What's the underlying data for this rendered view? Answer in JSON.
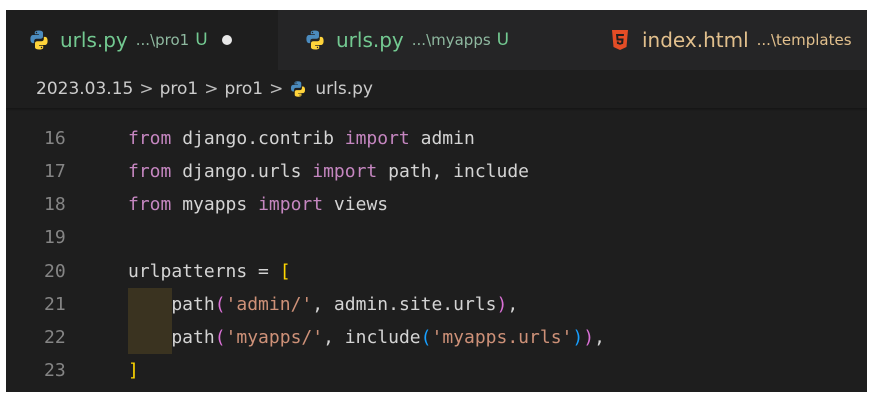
{
  "tabs": [
    {
      "name": "urls.py",
      "path": "...\\pro1",
      "flag": "U",
      "dirty": true,
      "icon": "python-icon",
      "active": true
    },
    {
      "name": "urls.py",
      "path": "...\\myapps",
      "flag": "U",
      "dirty": false,
      "icon": "python-icon",
      "active": false
    },
    {
      "name": "index.html",
      "path": "...\\templates",
      "flag": "",
      "dirty": false,
      "icon": "html5-icon",
      "active": false
    }
  ],
  "breadcrumb": {
    "items": [
      "2023.03.15",
      "pro1",
      "pro1",
      "urls.py"
    ],
    "separator": ">"
  },
  "editor": {
    "line_numbers": [
      "16",
      "17",
      "18",
      "19",
      "20",
      "21",
      "22",
      "23"
    ],
    "lines": [
      [
        "from",
        " django.contrib ",
        "import",
        " admin"
      ],
      [
        "from",
        " django.urls ",
        "import",
        " path, include"
      ],
      [
        "from",
        " myapps ",
        "import",
        " views"
      ],
      [],
      [
        "urlpatterns = ",
        "["
      ],
      [
        "    path",
        "(",
        "'admin/'",
        ", admin.site.urls",
        ")",
        ","
      ],
      [
        "    path",
        "(",
        "'myapps/'",
        ", include",
        "(",
        "'myapps.urls'",
        ")",
        ")",
        ","
      ],
      [
        "]"
      ]
    ]
  },
  "colors": {
    "keyword": "#c586c0",
    "string": "#ce9178",
    "bracket_level1": "#ffd700",
    "bracket_level2": "#da70d6",
    "bracket_level3": "#179fff",
    "untracked": "#73c991",
    "html_tab": "#e2c08d",
    "editor_bg": "#1e1e1e"
  }
}
